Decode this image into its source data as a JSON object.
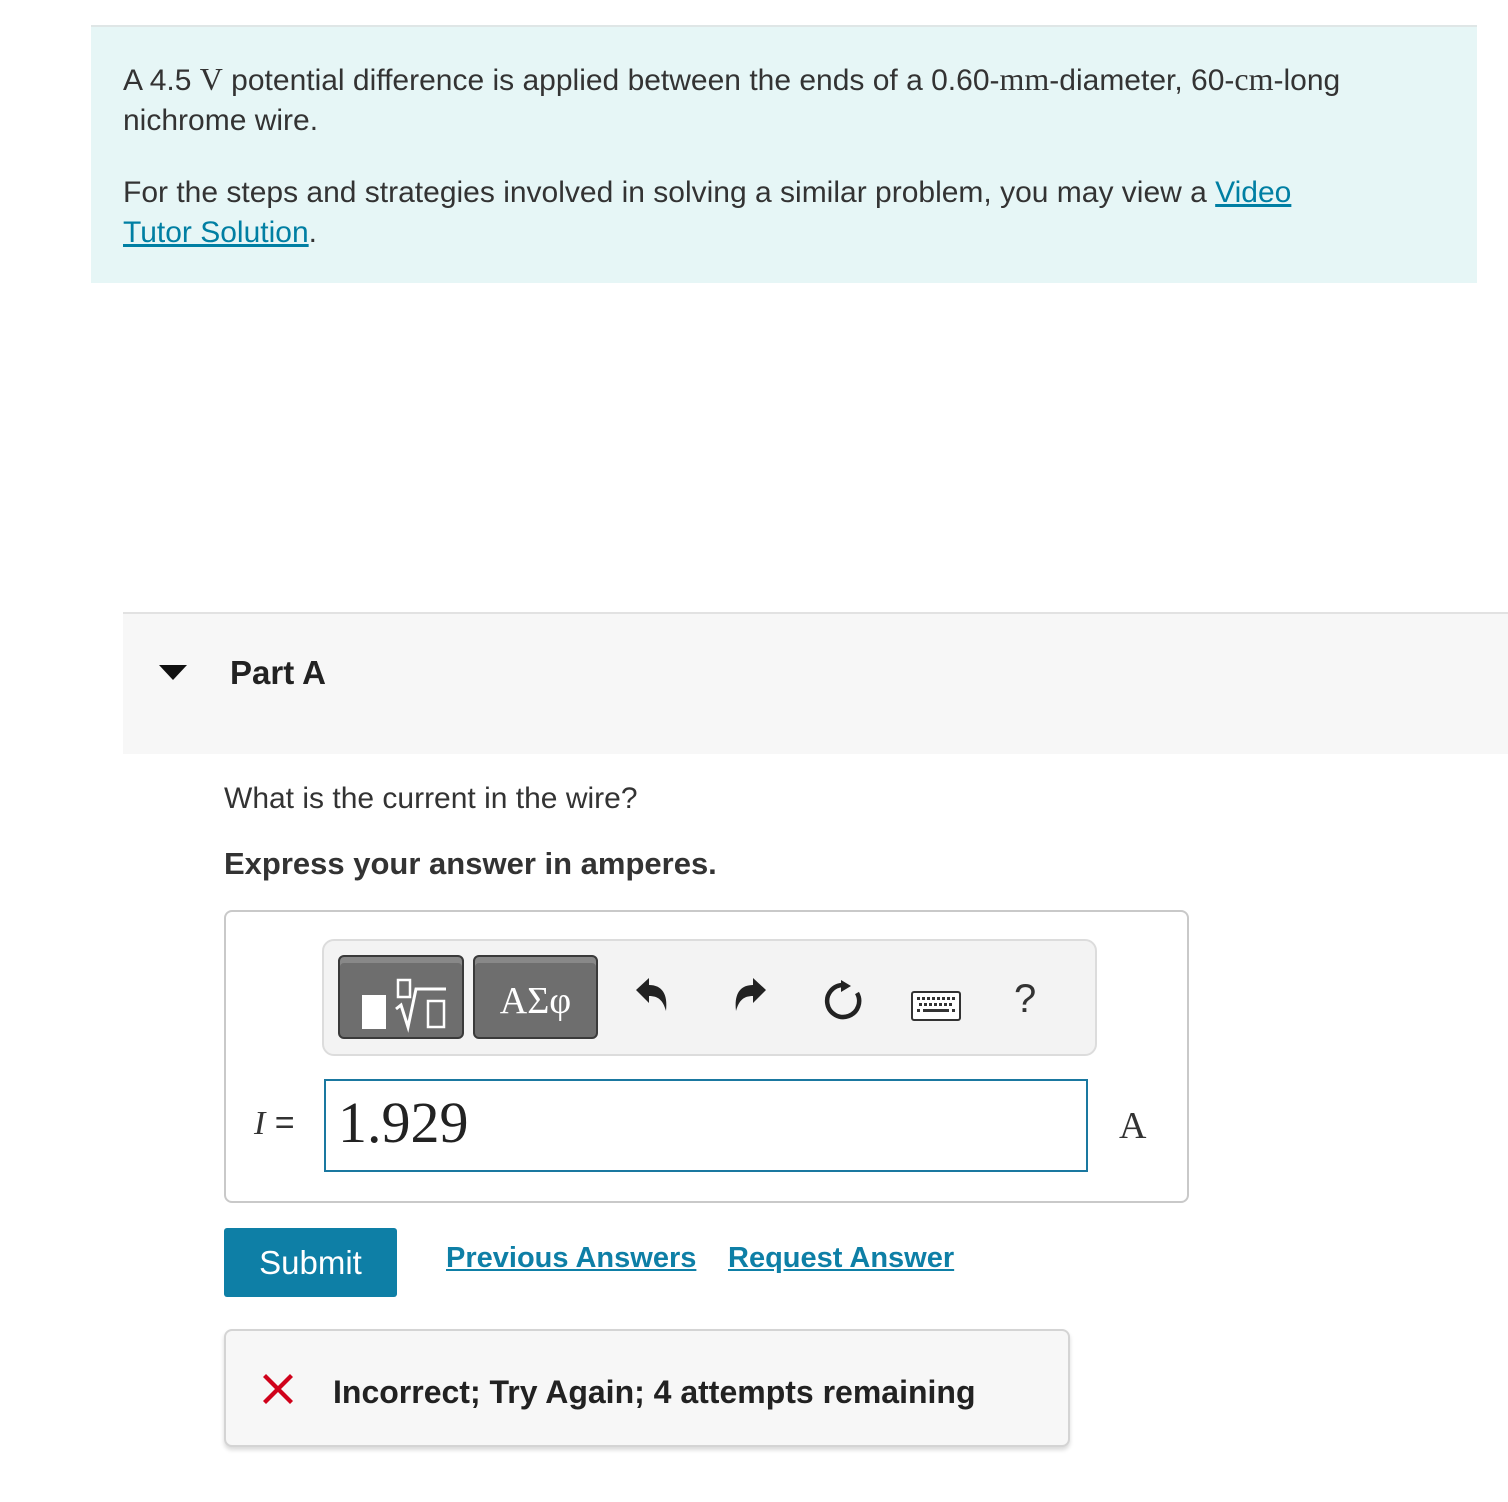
{
  "intro": {
    "line1_prefix": "A 4.5 ",
    "voltage_unit": "V",
    "line1_mid": " potential difference is applied between the ends of a 0.60-",
    "diameter_unit": "mm",
    "line1_suffix": "-diameter, 60-",
    "length_unit": "cm",
    "line1_end": "-long nichrome wire.",
    "hint_text": "For the steps and strategies involved in solving a similar problem, you may view a ",
    "video_link": "Video Tutor Solution",
    "hint_end": "."
  },
  "part": {
    "title": "Part A",
    "question": "What is the current in the wire?",
    "instruction": "Express your answer in amperes."
  },
  "toolbar": {
    "symbols_label": "ΑΣφ",
    "help_label": "?"
  },
  "answer": {
    "variable": "I",
    "equals": " =",
    "value": "1.929",
    "unit": "A"
  },
  "actions": {
    "submit_label": "Submit",
    "previous_answers": "Previous Answers",
    "request_answer": "Request Answer"
  },
  "feedback": {
    "text": "Incorrect; Try Again; 4 attempts remaining",
    "icon_color": "#d0021b"
  },
  "colors": {
    "accent": "#0e7fa6",
    "intro_background": "#e6f6f6"
  }
}
